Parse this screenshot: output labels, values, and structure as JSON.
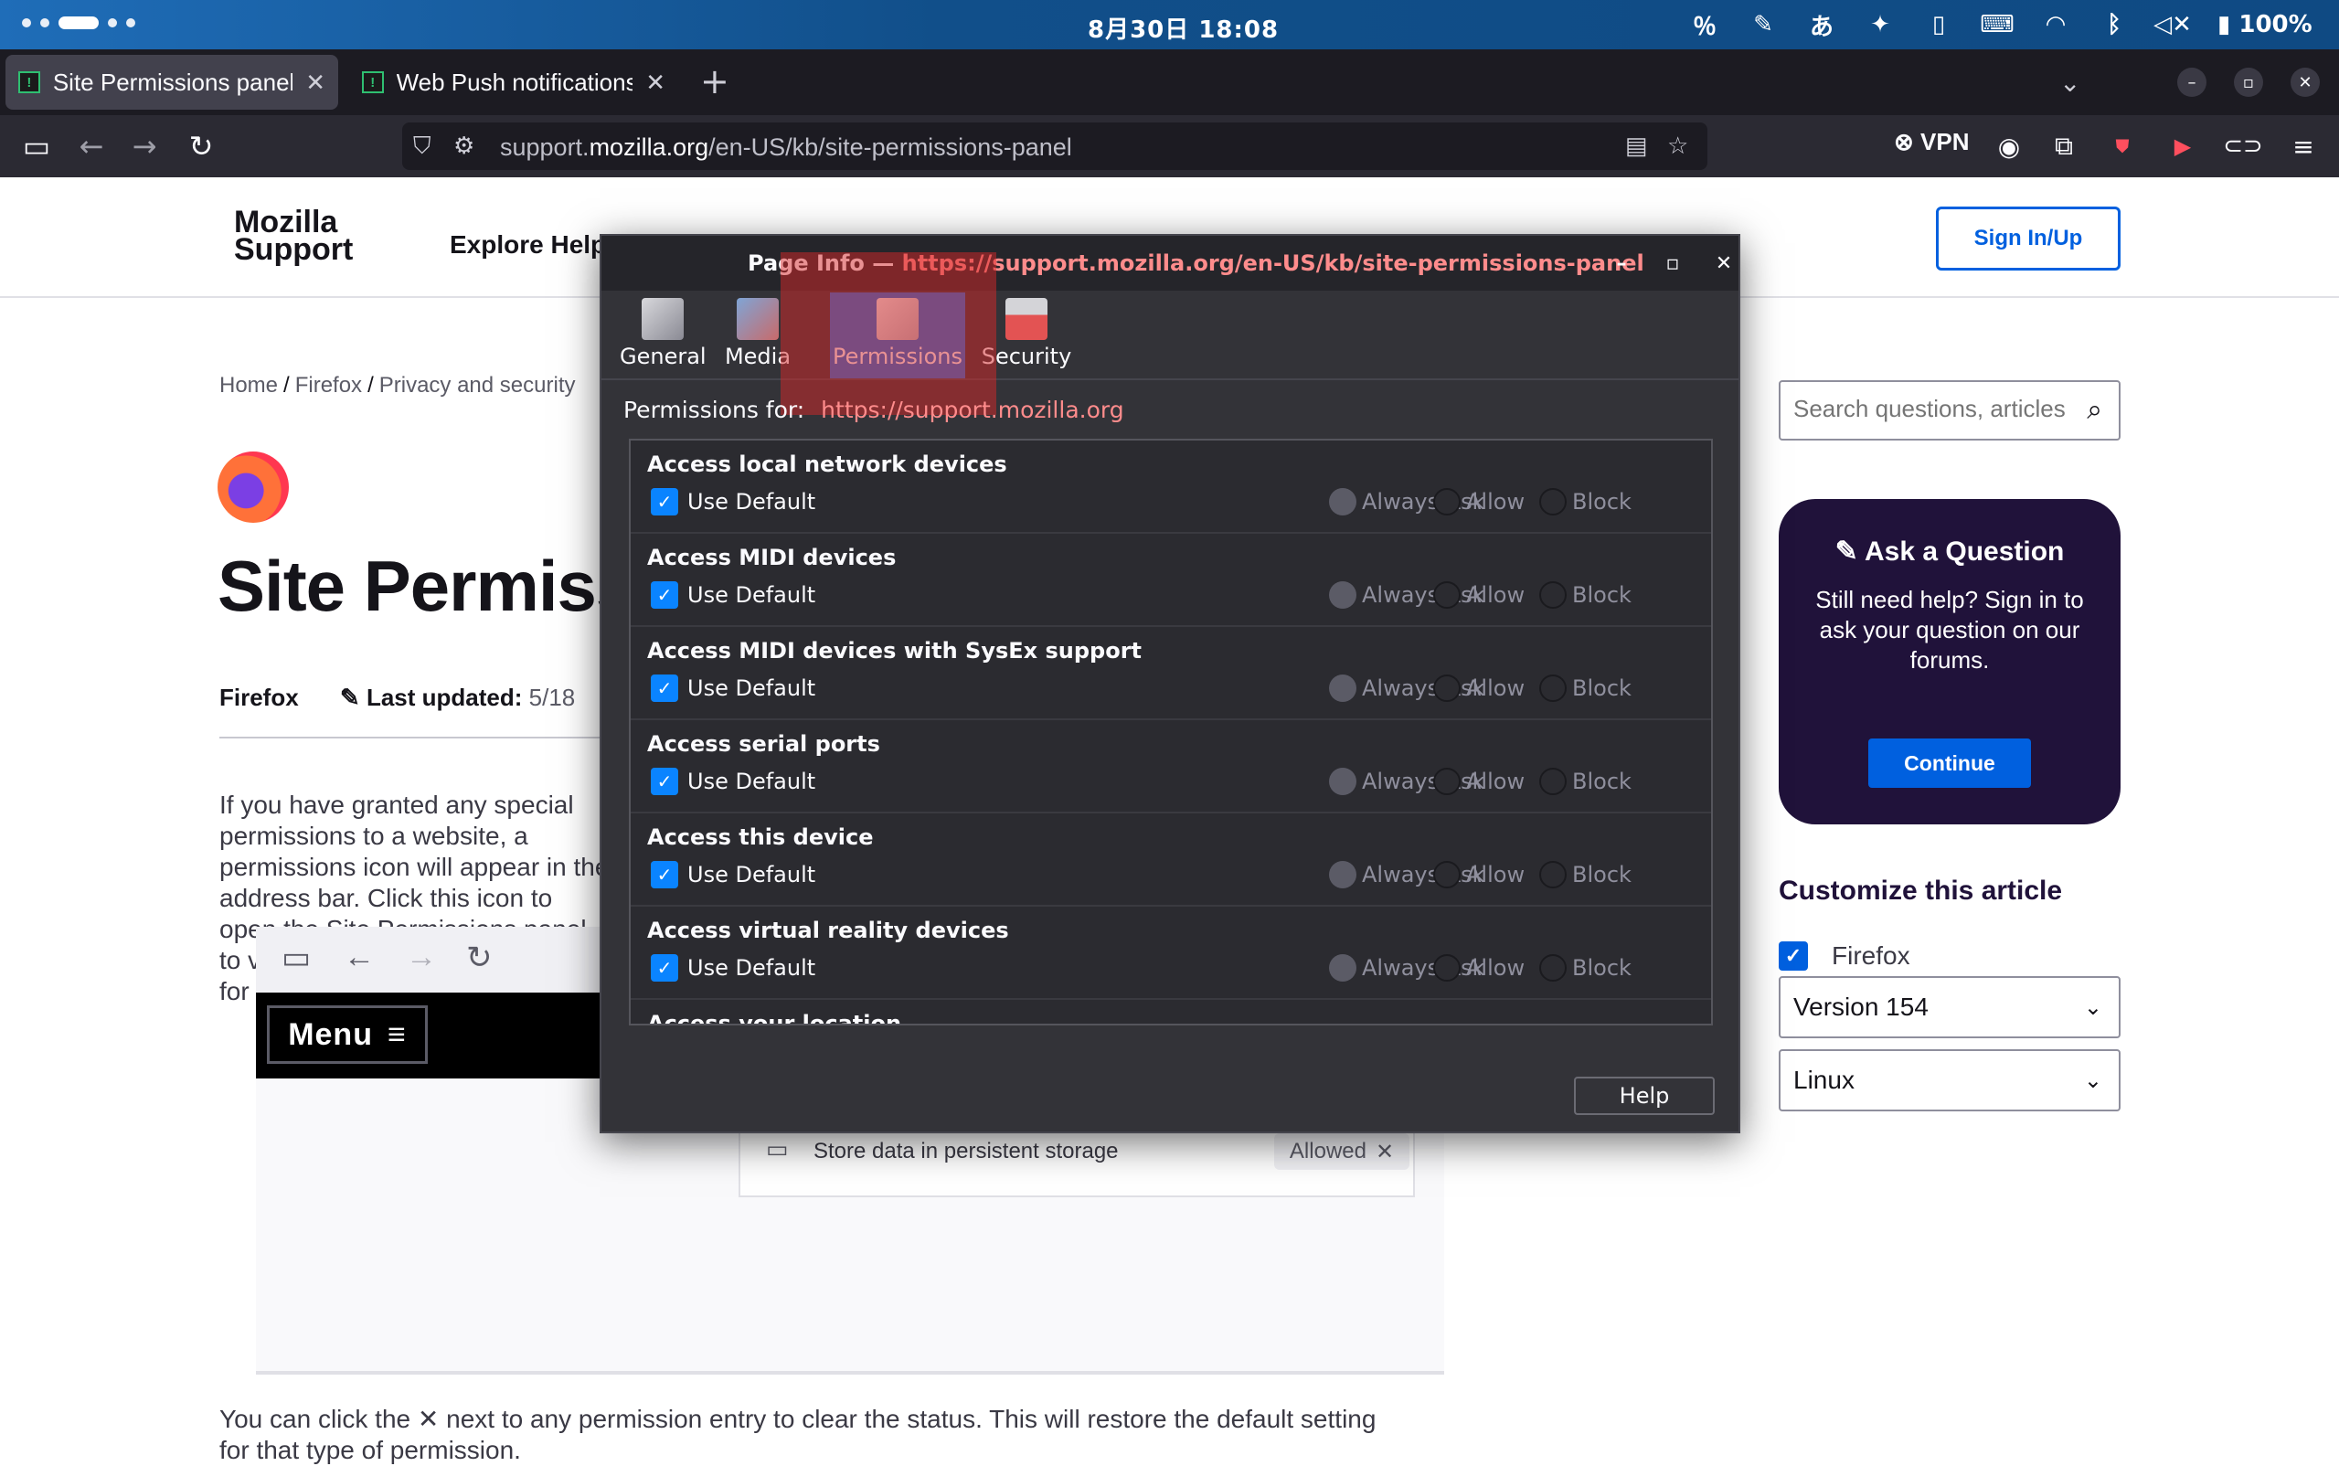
{
  "os": {
    "clock": "8月30日 18:08",
    "battery": "100%",
    "ime": "あ"
  },
  "browser": {
    "tabs": [
      {
        "label": "Site Permissions panel",
        "favicon": "support-favicon"
      },
      {
        "label": "Web Push notifications",
        "favicon": "support-favicon"
      }
    ],
    "url_prefix": "support.",
    "url_domain": "mozilla.org",
    "url_path": "/en-US/kb/site-permissions-panel",
    "vpn_label": "VPN"
  },
  "site": {
    "logo_line1": "Mozilla",
    "logo_line2": "Support",
    "explore": "Explore Help",
    "signin": "Sign In/Up",
    "breadcrumb": [
      "Home",
      "Firefox",
      "Privacy and security"
    ],
    "title": "Site Permissions panel",
    "meta_product": "Firefox",
    "meta_updated_label": "Last updated:",
    "meta_updated_value": "5/18",
    "para1": "If you have granted any special permissions to a website, a permissions icon will appear in the address bar. Click this icon to open the Site Permissions panel to view and manage permissions for the website.",
    "shot_menu": "Menu",
    "shot_row_text": "Store data in persistent storage",
    "shot_row_pill": "Allowed",
    "para2": "You can click the ✕ next to any permission entry to clear the status. This will restore the default setting for that type of permission.",
    "search_placeholder": "Search questions, articles",
    "ask_title": "Ask a Question",
    "ask_text": "Still need help? Sign in to ask your question on our forums.",
    "ask_button": "Continue",
    "customize_title": "Customize this article",
    "customize_product": "Firefox",
    "version_select": "Version 154",
    "os_select": "Linux"
  },
  "dialog": {
    "title_prefix": "Page Info — ",
    "title_url": "https://support.mozilla.org/en-US/kb/site-permissions-panel",
    "tabs": [
      "General",
      "Media",
      "Permissions",
      "Security"
    ],
    "selected_tab": "Permissions",
    "perm_for_label": "Permissions for:",
    "perm_for_url": "https://support.mozilla.org",
    "use_default": "Use Default",
    "options": [
      "Always Ask",
      "Allow",
      "Block"
    ],
    "permissions": [
      "Access local network devices",
      "Access MIDI devices",
      "Access MIDI devices with SysEx support",
      "Access serial ports",
      "Access this device",
      "Access virtual reality devices",
      "Access your location"
    ],
    "help_button": "Help"
  }
}
